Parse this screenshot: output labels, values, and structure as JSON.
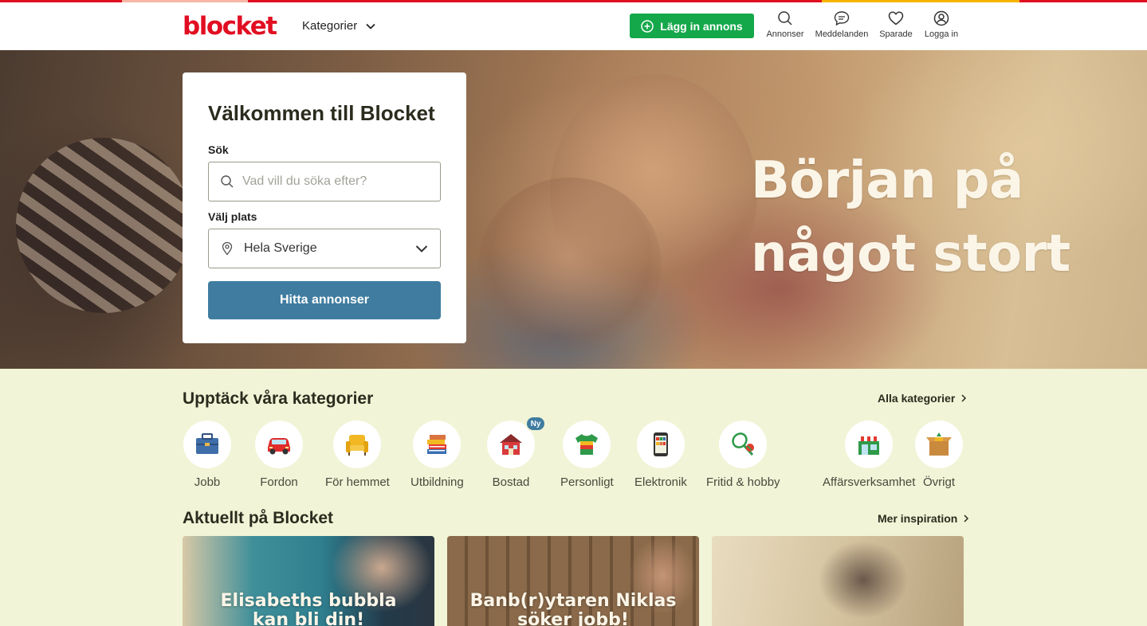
{
  "brand": {
    "logo_text": "blocket",
    "color": "#e10e22"
  },
  "stripe_colors": [
    "#e10e22",
    "#f6b7a4",
    "#e10e22",
    "#e10e22",
    "#f6b400",
    "#e10e22"
  ],
  "header": {
    "categories_label": "Kategorier",
    "post_ad_label": "Lägg in annons",
    "nav": [
      {
        "label": "Annonser",
        "icon": "search-icon"
      },
      {
        "label": "Meddelanden",
        "icon": "message-icon"
      },
      {
        "label": "Sparade",
        "icon": "heart-icon"
      },
      {
        "label": "Logga in",
        "icon": "user-icon"
      }
    ]
  },
  "hero": {
    "headline_line1": "Början på",
    "headline_line2": "något stort"
  },
  "search": {
    "title": "Välkommen till Blocket",
    "search_label": "Sök",
    "search_placeholder": "Vad vill du söka efter?",
    "location_label": "Välj plats",
    "location_value": "Hela Sverige",
    "submit_label": "Hitta annonser",
    "button_color": "#3f7ca0"
  },
  "categories": {
    "title": "Upptäck våra kategorier",
    "all_link": "Alla kategorier",
    "items": [
      {
        "label": "Jobb",
        "icon": "briefcase-icon"
      },
      {
        "label": "Fordon",
        "icon": "car-icon"
      },
      {
        "label": "För hemmet",
        "icon": "armchair-icon"
      },
      {
        "label": "Utbildning",
        "icon": "books-icon"
      },
      {
        "label": "Bostad",
        "icon": "house-icon",
        "badge": "Ny"
      },
      {
        "label": "Personligt",
        "icon": "tshirt-icon"
      },
      {
        "label": "Elektronik",
        "icon": "phone-icon"
      },
      {
        "label": "Fritid & hobby",
        "icon": "tennis-icon"
      },
      {
        "label": "Affärsverksamhet",
        "icon": "shop-icon"
      },
      {
        "label": "Övrigt",
        "icon": "box-icon"
      }
    ]
  },
  "inspiration": {
    "title": "Aktuellt på Blocket",
    "more_link": "Mer inspiration",
    "articles": [
      {
        "title_line1": "Elisabeths bubbla",
        "title_line2": "kan bli din!"
      },
      {
        "title_line1": "Banb(r)ytaren Niklas",
        "title_line2": "söker jobb!"
      },
      {
        "title_line1": "",
        "title_line2": ""
      }
    ]
  }
}
